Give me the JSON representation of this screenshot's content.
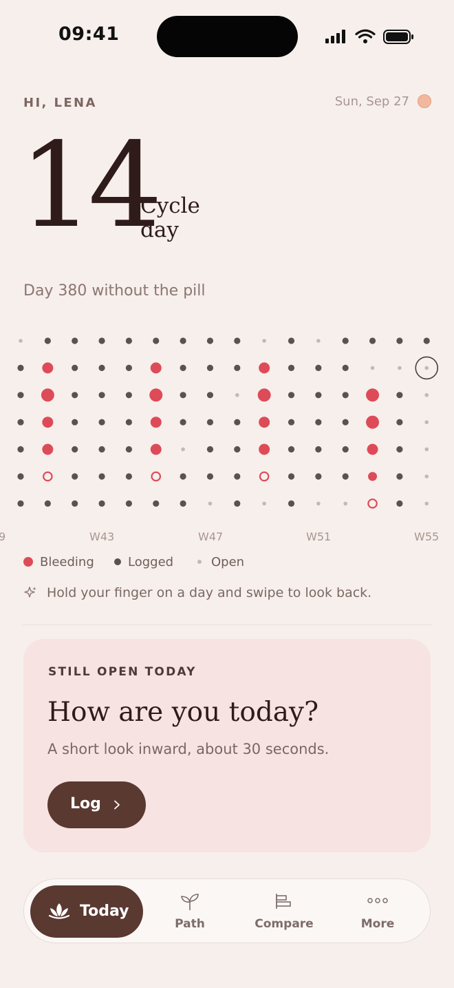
{
  "status": {
    "time": "09:41"
  },
  "header": {
    "greeting": "HI, LENA",
    "date": "Sun, Sep 27"
  },
  "cycle": {
    "day": "14",
    "day_label": "Cycle day",
    "pill_text": "Day 380 without the pill"
  },
  "calendar": {
    "week_labels": [
      "9",
      "W43",
      "W47",
      "W51",
      "W55"
    ],
    "today": {
      "column": 16,
      "row": 2
    },
    "grid": [
      "oLLLLLLLLoLoLLLL",
      "LBLLLBLLLBLLLooT",
      "LBLLLBLLoBLLLBLo",
      "LBLLLBLLLBLLLBLo",
      "LBLLLBoLLBLLLBLo",
      "LRLLLRLLLRLLLBLo",
      "LLLLLLLoLoLooRLo"
    ],
    "large_bleeding_rows": [
      2
    ],
    "medium_bleeding_rows": [
      1,
      3,
      4
    ],
    "legend": [
      {
        "label": "Bleeding",
        "color": "#de4b58"
      },
      {
        "label": "Logged",
        "color": "#5c5150"
      },
      {
        "label": "Open",
        "color": "#c3b8b4"
      }
    ],
    "hint": "Hold your finger on a day and swipe to look back."
  },
  "card": {
    "kicker": "STILL OPEN TODAY",
    "title": "How are you today?",
    "subtitle": "A short look inward, about 30 seconds.",
    "button_label": "Log"
  },
  "nav": {
    "items": [
      {
        "label": "Today",
        "icon": "lotus-icon",
        "active": true
      },
      {
        "label": "Path",
        "icon": "sprout-icon",
        "active": false
      },
      {
        "label": "Compare",
        "icon": "bar-compare-icon",
        "active": false
      },
      {
        "label": "More",
        "icon": "more-dots-icon",
        "active": false
      }
    ]
  },
  "colors": {
    "accent": "#5a3931",
    "bleeding": "#de4b58",
    "logged": "#5c5150",
    "open": "#c3b8b4",
    "background": "#f7efec",
    "card": "#f7e3e1"
  }
}
